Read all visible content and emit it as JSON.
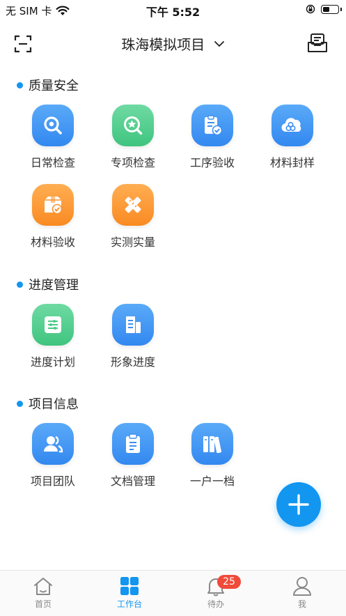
{
  "status_bar": {
    "carrier": "无 SIM 卡",
    "time": "下午 5:52",
    "battery_level": 0.45
  },
  "header": {
    "title": "珠海模拟项目"
  },
  "sections": [
    {
      "title": "质量安全",
      "items": [
        {
          "label": "日常检查",
          "icon": "search-icon",
          "color": "blue"
        },
        {
          "label": "专项检查",
          "icon": "star-search-icon",
          "color": "green"
        },
        {
          "label": "工序验收",
          "icon": "clipboard-check-icon",
          "color": "blue"
        },
        {
          "label": "材料封样",
          "icon": "material-sample-icon",
          "color": "blue"
        },
        {
          "label": "材料验收",
          "icon": "package-check-icon",
          "color": "orange"
        },
        {
          "label": "实测实量",
          "icon": "ruler-pencil-icon",
          "color": "orange"
        }
      ]
    },
    {
      "title": "进度管理",
      "items": [
        {
          "label": "进度计划",
          "icon": "schedule-icon",
          "color": "green"
        },
        {
          "label": "形象进度",
          "icon": "building-icon",
          "color": "blue"
        }
      ]
    },
    {
      "title": "项目信息",
      "items": [
        {
          "label": "项目团队",
          "icon": "team-icon",
          "color": "blue"
        },
        {
          "label": "文档管理",
          "icon": "document-icon",
          "color": "blue"
        },
        {
          "label": "一户一档",
          "icon": "binders-icon",
          "color": "blue"
        }
      ]
    }
  ],
  "tabs": [
    {
      "label": "首页",
      "icon": "home-icon",
      "active": false
    },
    {
      "label": "工作台",
      "icon": "grid-icon",
      "active": true
    },
    {
      "label": "待办",
      "icon": "bell-icon",
      "active": false,
      "badge": "25"
    },
    {
      "label": "我",
      "icon": "person-icon",
      "active": false
    }
  ],
  "colors": {
    "accent": "#1296f0",
    "badge": "#f04a3a",
    "blue": "#3d8ff2",
    "green": "#4cca88",
    "orange": "#fb9230"
  }
}
